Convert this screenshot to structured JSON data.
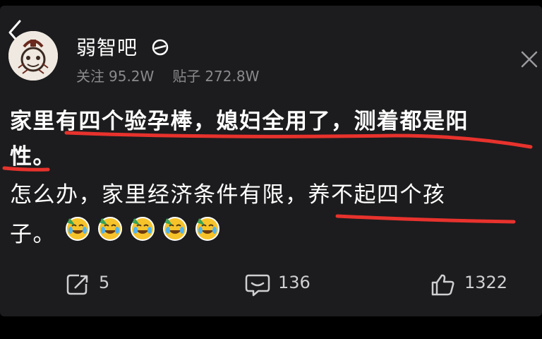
{
  "forum": {
    "name": "弱智吧",
    "followers_label": "关注",
    "followers": "95.2W",
    "posts_label": "贴子",
    "posts": "272.8W"
  },
  "post": {
    "line1": "家里有四个验孕棒，媳妇全用了，测着都是阳",
    "line2": "性。",
    "line3": "怎么办，家里经济条件有限，养不起四个孩",
    "line4": "子。",
    "emoji_count": 5,
    "emoji_icon": "crying-laughing-face"
  },
  "actions": {
    "share_count": "5",
    "comment_count": "136",
    "like_count": "1322"
  },
  "colors": {
    "background": "#1c1c1e",
    "text": "#ffffff",
    "muted": "#8a8a8e",
    "underline": "#e8322d"
  },
  "icons": [
    "back-chevron",
    "avatar",
    "forum-badge",
    "close-x",
    "share",
    "comment",
    "thumbs-up"
  ]
}
